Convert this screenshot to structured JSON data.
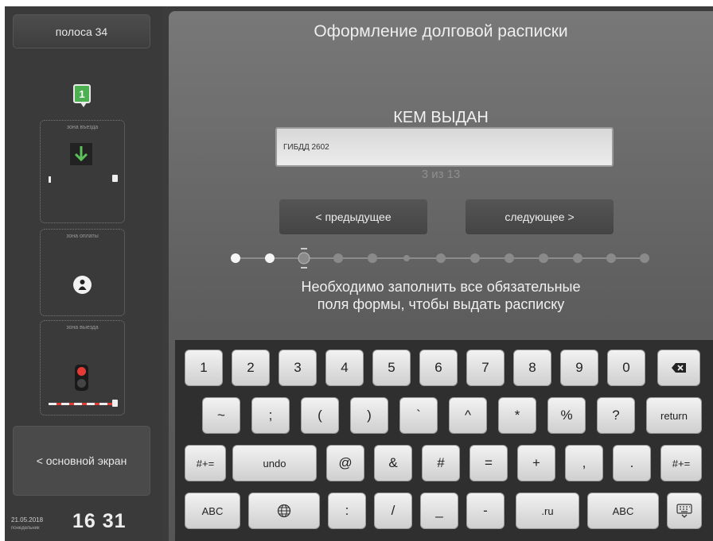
{
  "sidebar": {
    "lane_label": "полоса 34",
    "badge_number": "1",
    "zones": [
      {
        "label": "зона въезда"
      },
      {
        "label": "зона оплаты"
      },
      {
        "label": "зона выезда"
      }
    ],
    "home_label": "< основной экран",
    "date": "21.05.2018",
    "weekday": "понедельник",
    "time": "16 31"
  },
  "main": {
    "title": "Оформление долговой расписки",
    "field_label": "КЕМ ВЫДАН",
    "field_value": "ГИБДД 2602",
    "counter": "3 из 13",
    "prev_label": "< предыдущее",
    "next_label": "следующее >",
    "message_line1": "Необходимо заполнить все обязательные",
    "message_line2": "поля формы, чтобы выдать расписку",
    "progress": {
      "current_step": 3,
      "total_steps": 13
    }
  },
  "keyboard": {
    "rows": [
      [
        "1",
        "2",
        "3",
        "4",
        "5",
        "6",
        "7",
        "8",
        "9",
        "0"
      ],
      [
        "~",
        ";",
        "(",
        ")",
        "`",
        "^",
        "*",
        "%",
        "?",
        "return"
      ],
      [
        "#+=",
        "undo",
        "@",
        "&",
        "#",
        "=",
        "+",
        ",",
        ".",
        "#+="
      ],
      [
        "ABC",
        ":",
        "/",
        "_",
        "-",
        ".ru",
        "ABC"
      ]
    ],
    "icons": {
      "backspace": "backspace-icon",
      "globe": "globe-icon",
      "hide": "keyboard-hide-icon"
    }
  },
  "colors": {
    "accent_green": "#4caf50",
    "signal_red": "#e53935"
  }
}
